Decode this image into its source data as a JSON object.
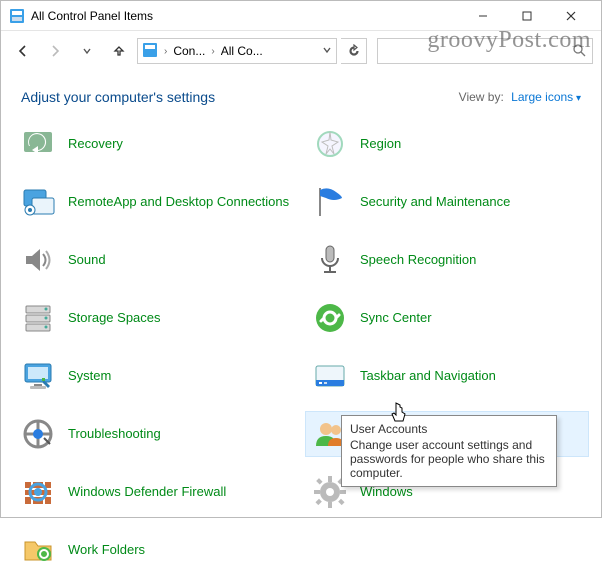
{
  "window": {
    "title": "All Control Panel Items"
  },
  "breadcrumb": {
    "crumb1": "Con...",
    "crumb2": "All Co..."
  },
  "heading": "Adjust your computer's settings",
  "viewby": {
    "label": "View by:",
    "value": "Large icons"
  },
  "items": {
    "left": [
      {
        "label": "Recovery"
      },
      {
        "label": "RemoteApp and Desktop Connections"
      },
      {
        "label": "Sound"
      },
      {
        "label": "Storage Spaces"
      },
      {
        "label": "System"
      },
      {
        "label": "Troubleshooting"
      },
      {
        "label": "Windows Defender Firewall"
      },
      {
        "label": "Work Folders"
      }
    ],
    "right": [
      {
        "label": "Region"
      },
      {
        "label": "Security and Maintenance"
      },
      {
        "label": "Speech Recognition"
      },
      {
        "label": "Sync Center"
      },
      {
        "label": "Taskbar and Navigation"
      },
      {
        "label": "User Accounts"
      },
      {
        "label": "Windows"
      }
    ]
  },
  "tooltip": {
    "title": "User Accounts",
    "body": "Change user account settings and passwords for people who share this computer."
  },
  "watermark": "groovyPost.com"
}
